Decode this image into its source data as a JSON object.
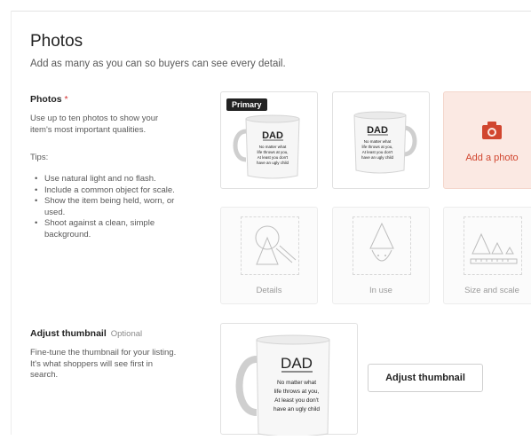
{
  "section": {
    "title": "Photos",
    "subtitle": "Add as many as you can so buyers can see every detail."
  },
  "photos_field": {
    "label": "Photos",
    "required_mark": "*",
    "description": "Use up to ten photos to show your item's most important qualities.",
    "tips_label": "Tips:",
    "tips": [
      "Use natural light and no flash.",
      "Include a common object for scale.",
      "Show the item being held, worn, or used.",
      "Shoot against a clean, simple background."
    ]
  },
  "tiles": {
    "primary_badge": "Primary",
    "add_photo_label": "Add a photo",
    "placeholders": [
      "Details",
      "In use",
      "Size and scale"
    ]
  },
  "mug": {
    "heading": "DAD",
    "lines": [
      "No matter what",
      "life throws at you,",
      "At least you don't",
      "have an ugly child"
    ]
  },
  "thumbnail": {
    "label": "Adjust thumbnail",
    "optional": "Optional",
    "description": "Fine-tune the thumbnail for your listing. It's what shoppers will see first in search.",
    "button_label": "Adjust thumbnail"
  },
  "colors": {
    "accent": "#d1462f",
    "add_photo_bg": "#fbe9e3",
    "badge_bg": "#222222"
  },
  "icons": [
    "camera-icon",
    "cone-ball-icon",
    "cone-face-icon",
    "size-scale-icon"
  ]
}
